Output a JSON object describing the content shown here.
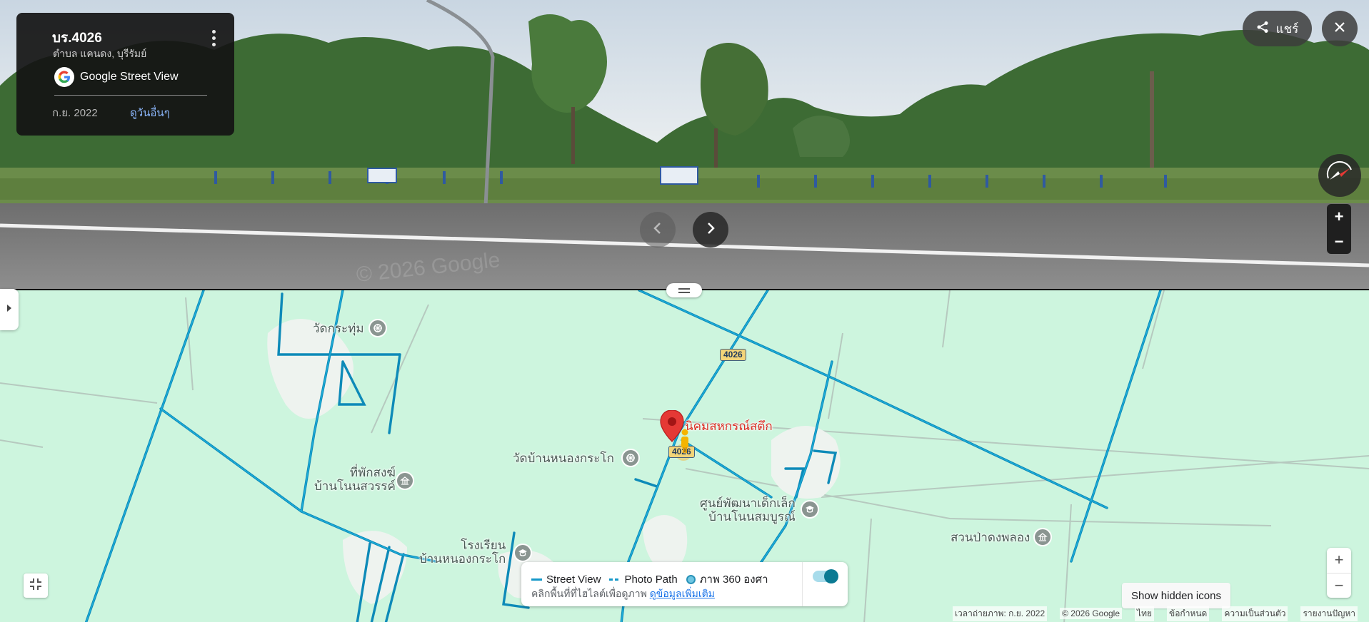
{
  "info_card": {
    "title": "บร.4026",
    "subtitle": "ตำบล แคนดง, บุรีรัมย์",
    "brand": "Google Street View",
    "date": "ก.ย. 2022",
    "see_other_dates": "ดูวันอื่นๆ"
  },
  "toolbar": {
    "share_label": "แชร์"
  },
  "pano": {
    "watermark": "© 2026 Google"
  },
  "map": {
    "road_shields": [
      "4026",
      "4026"
    ],
    "labels": {
      "wat_kratum": "วัดกระทุ่ม",
      "nikhom": "นิคมสหกรณ์สตึก",
      "wat_nong_karako": "วัดบ้านหนองกระโก",
      "rest_house_line1": "ที่พักสงฆ์",
      "rest_house_line2": "บ้านโนนสวรรค์",
      "child_center_line1": "ศูนย์พัฒนาเด็กเล็ก",
      "child_center_line2": "บ้านโนนสมบูรณ์",
      "school_line1": "โรงเรียน",
      "school_line2": "บ้านหนองกระโก",
      "park": "สวนป่าดงพลอง"
    }
  },
  "legend": {
    "street_view": "Street View",
    "photo_path": "Photo Path",
    "photo_360": "ภาพ 360 องศา",
    "hint": "คลิกพื้นที่ที่ไฮไลต์เพื่อดูภาพ",
    "learn_more": "ดูข้อมูลเพิ่มเติม",
    "colors": {
      "line": "#1598c9",
      "toggle_on": "#0b7a93"
    }
  },
  "hidden_icons_label": "Show hidden icons",
  "footer": {
    "capture_date": "เวลาถ่ายภาพ: ก.ย. 2022",
    "copyright": "© 2026 Google",
    "language": "ไทย",
    "terms": "ข้อกำหนด",
    "privacy": "ความเป็นส่วนตัว",
    "report": "รายงานปัญหา"
  }
}
